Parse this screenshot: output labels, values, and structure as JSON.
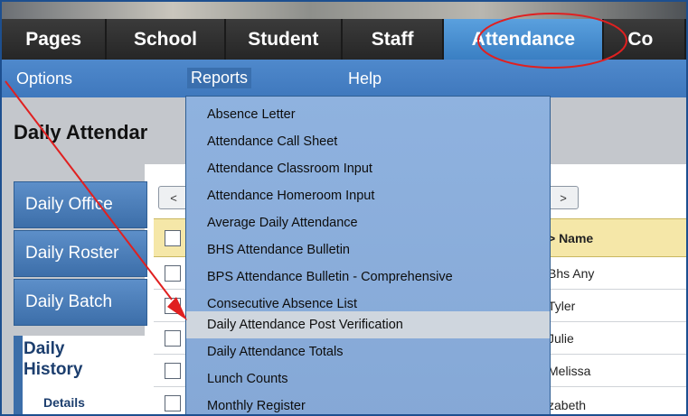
{
  "tabs": [
    {
      "label": "Pages"
    },
    {
      "label": "School"
    },
    {
      "label": "Student"
    },
    {
      "label": "Staff"
    },
    {
      "label": "Attendance"
    },
    {
      "label": "Co"
    }
  ],
  "submenu": {
    "options": "Options",
    "reports": "Reports",
    "help": "Help"
  },
  "page": {
    "title": "Daily Attendar"
  },
  "side_nav": {
    "daily_office": "Daily Office",
    "daily_roster": "Daily Roster",
    "daily_batch": "Daily Batch",
    "daily_history_line1": "Daily",
    "daily_history_line2": "History",
    "details": "Details"
  },
  "pager": {
    "prev": "<",
    "next": ">"
  },
  "grid": {
    "name_header": "> Name",
    "rows": [
      "Bhs Any",
      "Tyler",
      "Julie",
      "Melissa",
      "zabeth"
    ]
  },
  "reports_menu": [
    "Absence Letter",
    "Attendance Call Sheet",
    "Attendance Classroom Input",
    "Attendance Homeroom Input",
    "Average Daily Attendance",
    "BHS Attendance Bulletin",
    "BPS Attendance Bulletin - Comprehensive",
    "Consecutive Absence List",
    "Daily Attendance Post Verification",
    "Daily Attendance Totals",
    "Lunch Counts",
    "Monthly Register"
  ],
  "highlighted_item_index": 8,
  "colors": {
    "accent_blue": "#3f78bd",
    "annotation_red": "#e02020",
    "header_yellow": "#f5e7a8"
  }
}
